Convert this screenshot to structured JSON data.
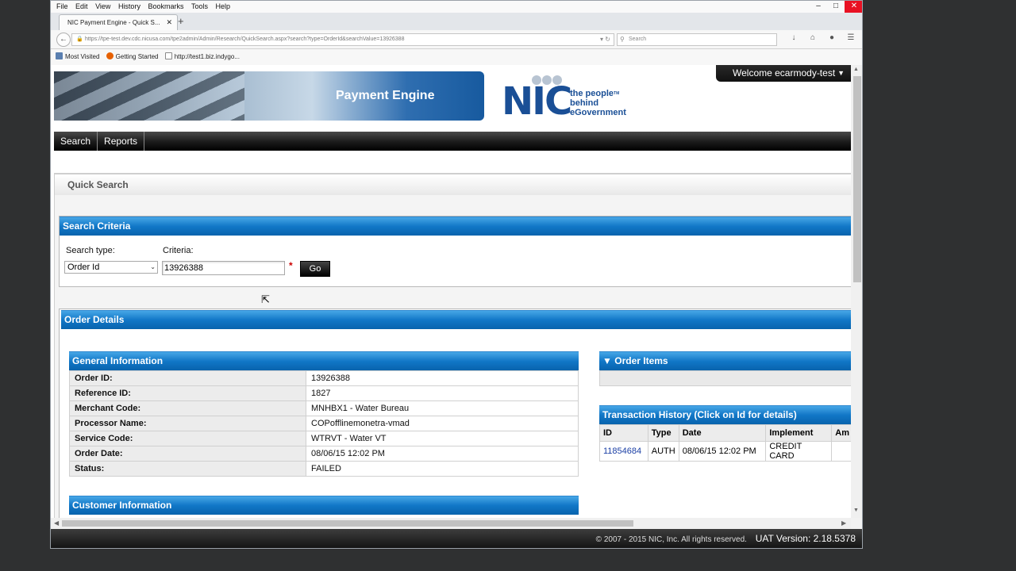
{
  "browser": {
    "menu": [
      "File",
      "Edit",
      "View",
      "History",
      "Bookmarks",
      "Tools",
      "Help"
    ],
    "tab_title": "NIC Payment Engine - Quick S...",
    "url": "https://tpe-test.dev.cdc.nicusa.com/tpe2admin/Admin/Research/QuickSearch.aspx?search?type=OrderId&searchValue=13926388",
    "search_placeholder": "Search",
    "bookmarks": [
      "Most Visited",
      "Getting Started",
      "http://test1.biz.indygo..."
    ]
  },
  "header": {
    "banner_title": "Payment Engine",
    "logo_text": "NIC",
    "logo_tagline": [
      "the people",
      "behind",
      "eGovernment"
    ],
    "logo_tm": "TM",
    "welcome": "Welcome ecarmody-test"
  },
  "nav": [
    "Search",
    "Reports"
  ],
  "quick_search": {
    "title": "Quick Search",
    "criteria_header": "Search Criteria",
    "search_type_label": "Search type:",
    "criteria_label": "Criteria:",
    "search_type_value": "Order Id",
    "criteria_value": "13926388",
    "required_mark": "*",
    "go_label": "Go"
  },
  "order_details": {
    "header": "Order Details",
    "general_header": "General Information",
    "general": [
      {
        "k": "Order ID:",
        "v": "13926388"
      },
      {
        "k": "Reference ID:",
        "v": "1827"
      },
      {
        "k": "Merchant Code:",
        "v": "MNHBX1 - Water Bureau"
      },
      {
        "k": "Processor Name:",
        "v": "COPofflinemonetra-vmad"
      },
      {
        "k": "Service Code:",
        "v": "WTRVT - Water VT"
      },
      {
        "k": "Order Date:",
        "v": "08/06/15 12:02 PM"
      },
      {
        "k": "Status:",
        "v": "FAILED"
      }
    ],
    "order_items_header": "Order Items",
    "txn_header": "Transaction History",
    "txn_note": "(Click on Id for details)",
    "txn_columns": [
      "ID",
      "Type",
      "Date",
      "Implement",
      "Am"
    ],
    "txn_rows": [
      [
        "11854684",
        "AUTH",
        "08/06/15 12:02 PM",
        "CREDIT CARD",
        ""
      ]
    ],
    "customer_header": "Customer Information"
  },
  "footer": {
    "copyright": "© 2007 - 2015 NIC, Inc. All rights reserved.",
    "version": "UAT Version: 2.18.5378"
  }
}
